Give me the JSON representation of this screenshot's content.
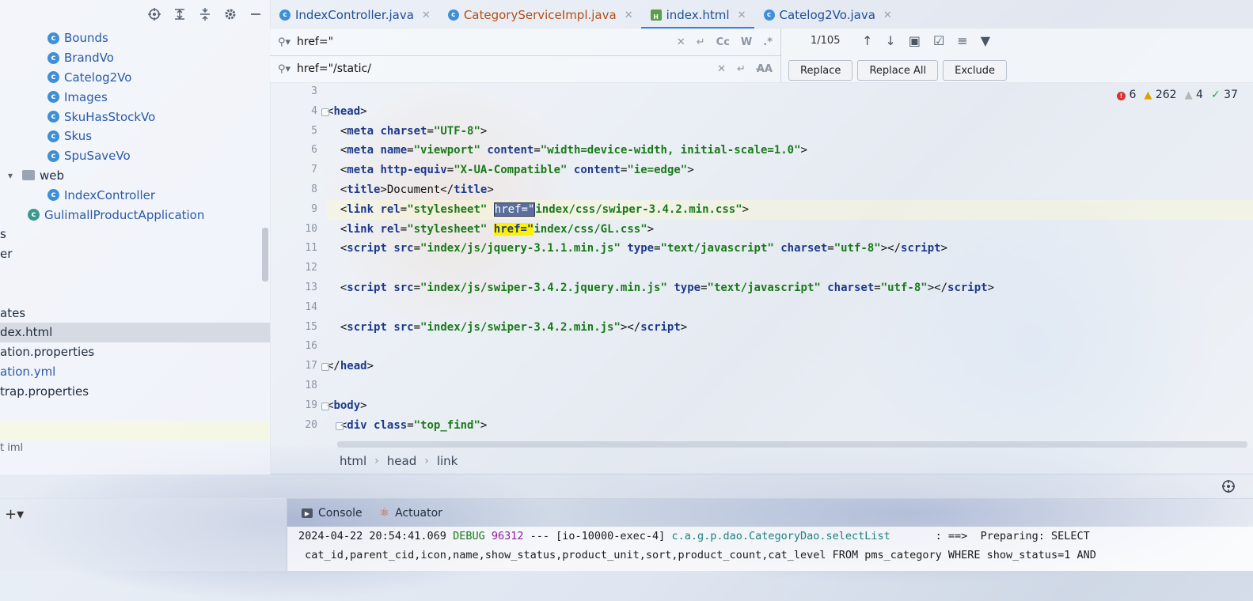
{
  "project_tree": {
    "items": [
      {
        "label": "Bounds",
        "type": "class"
      },
      {
        "label": "BrandVo",
        "type": "class"
      },
      {
        "label": "Catelog2Vo",
        "type": "class"
      },
      {
        "label": "Images",
        "type": "class"
      },
      {
        "label": "SkuHasStockVo",
        "type": "class"
      },
      {
        "label": "Skus",
        "type": "class"
      },
      {
        "label": "SpuSaveVo",
        "type": "class"
      },
      {
        "label": "web",
        "type": "folder"
      },
      {
        "label": "IndexController",
        "type": "class"
      },
      {
        "label": "GulimallProductApplication",
        "type": "app"
      },
      {
        "label": "s"
      },
      {
        "label": "er"
      },
      {
        "label": ""
      },
      {
        "label": ""
      },
      {
        "label": "ates"
      },
      {
        "label": "dex.html"
      },
      {
        "label": "ation.properties"
      },
      {
        "label": "ation.yml"
      },
      {
        "label": "trap.properties"
      },
      {
        "label": ""
      },
      {
        "label": ""
      },
      {
        "label": "t iml"
      }
    ]
  },
  "tabs": [
    {
      "label": "IndexController.java",
      "icon": "c"
    },
    {
      "label": "CategoryServiceImpl.java",
      "icon": "c"
    },
    {
      "label": "index.html",
      "icon": "html"
    },
    {
      "label": "Catelog2Vo.java",
      "icon": "c"
    }
  ],
  "find": {
    "search_value": "href=\"",
    "replace_value": "href=\"/static/",
    "match_count": "1/105",
    "opt_case": "Cc",
    "opt_word": "W",
    "opt_regex": ".*",
    "replace_label": "Replace",
    "replace_all_label": "Replace All",
    "exclude_label": "Exclude"
  },
  "inspections": {
    "errors": "6",
    "warnings": "262",
    "weak": "4",
    "typos": "37"
  },
  "code": {
    "line_numbers": [
      "3",
      "4",
      "5",
      "6",
      "7",
      "8",
      "9",
      "10",
      "11",
      "12",
      "13",
      "14",
      "15",
      "16",
      "17",
      "18",
      "19",
      "20"
    ]
  },
  "breadcrumb": [
    "html",
    "head",
    "link"
  ],
  "console": {
    "tab_console": "Console",
    "tab_actuator": "Actuator",
    "line1_ts": "2024-04-22 20:54:41.069 ",
    "line1_level": "DEBUG",
    "line1_pid": " 96312",
    "line1_mid": " --- [io-10000-exec-4] ",
    "line1_class": "c.a.g.p.dao.CategoryDao.selectList",
    "line1_tail": "       : ==>  Preparing: SELECT",
    "line2": " cat_id,parent_cid,icon,name,show_status,product_unit,sort,product_count,cat_level FROM pms_category WHERE show_status=1 AND"
  }
}
